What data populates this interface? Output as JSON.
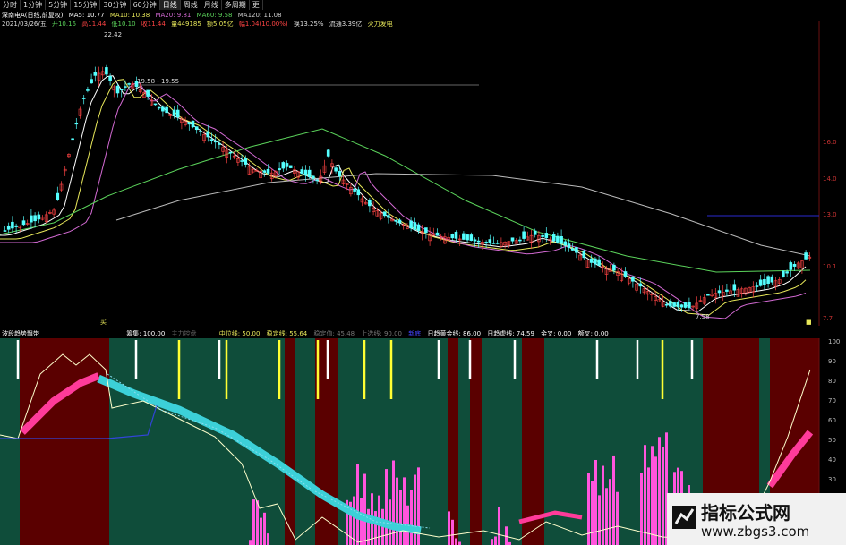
{
  "toolbar": {
    "tabs": [
      "分时",
      "1分钟",
      "5分钟",
      "15分钟",
      "30分钟",
      "60分钟",
      "日线",
      "周线",
      "月线",
      "多周期",
      "更"
    ],
    "active_index": 6
  },
  "info": {
    "stock_title": "深南电A(日线,前复权)",
    "ma5": "MA5: 10.77",
    "ma10": "MA10: 10.38",
    "ma20": "MA20: 9.81",
    "ma60": "MA60: 9.58",
    "ma120": "MA120: 11.08",
    "date": "2021/03/26/五",
    "open": "开10.16",
    "high": "高11.44",
    "low": "低10.10",
    "close": "收11.44",
    "volume": "量449185",
    "amount": "额5.05亿",
    "change": "幅1.04(10.00%)",
    "turnover": "换13.25%",
    "float_cap": "流通3.39亿",
    "concept": "火力发电"
  },
  "annotations": {
    "peak": "22.42",
    "range": "19.58 - 19.55",
    "low": "7.58"
  },
  "right_axis": [
    "16.0",
    "14.0",
    "13.0",
    "10.1",
    "7.7"
  ],
  "indicator": {
    "title": "波段趋势飘带",
    "chip": "筹集: 100.00",
    "label2": "主力控盘",
    "mid": "中位线: 50.00",
    "ret": "稳定线: 55.64",
    "ret2": "稳定值: 45.48",
    "upper": "上选线: 90.00",
    "lower": "新底",
    "golden": "日趋黄金线: 86.00",
    "trend": "日趋虚线: 74.59",
    "cross": "金叉: 0.00",
    "dead": "额叉: 0.00",
    "axis": [
      "100",
      "90",
      "80",
      "70",
      "60",
      "50",
      "40",
      "30",
      "20",
      "10"
    ]
  },
  "watermark": {
    "name": "指标公式网",
    "url": "www.zbgs3.com"
  },
  "colors": {
    "up": "#ff4444",
    "down": "#54ffff",
    "red_zone": "#5a0000",
    "green_zone": "#0f4d3a",
    "pink": "#ff3b9a",
    "cyan": "#3cd0d8"
  }
}
